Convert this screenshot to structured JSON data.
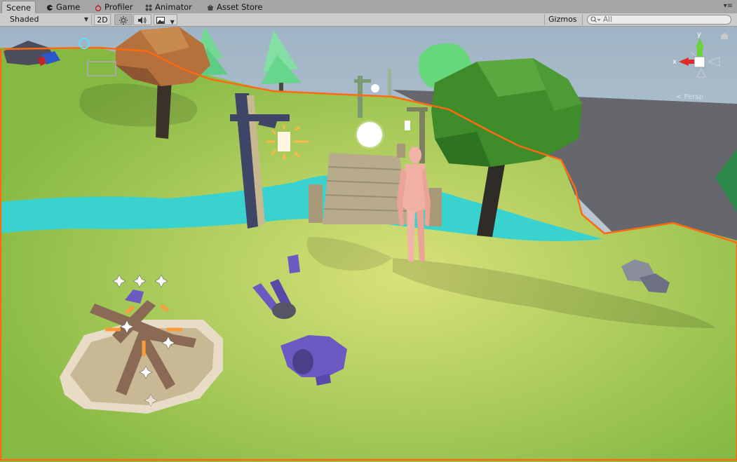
{
  "tabs": [
    {
      "label": "Scene",
      "icon": "scene-icon",
      "active": true
    },
    {
      "label": "Game",
      "icon": "game-icon",
      "active": false
    },
    {
      "label": "Profiler",
      "icon": "profiler-icon",
      "active": false
    },
    {
      "label": "Animator",
      "icon": "animator-icon",
      "active": false
    },
    {
      "label": "Asset Store",
      "icon": "asset-store-icon",
      "active": false
    }
  ],
  "toolbar": {
    "shading_mode": "Shaded",
    "mode_2d": "2D",
    "gizmos_label": "Gizmos",
    "search_placeholder": "All",
    "lighting_icon": "sun-icon",
    "audio_icon": "speaker-icon",
    "effects_icon": "image-icon"
  },
  "orientation_gizmo": {
    "y_label": "y",
    "x_label": "x",
    "projection_label": "Persp"
  },
  "colors": {
    "sky": "#b9c9d6",
    "ground": "#8fc24c",
    "river": "#39d2cf",
    "selection_outline": "#ff6a12",
    "tree_green": "#3e8d2a",
    "character": "#f2b3a8",
    "armor": "#6c5ac2"
  }
}
